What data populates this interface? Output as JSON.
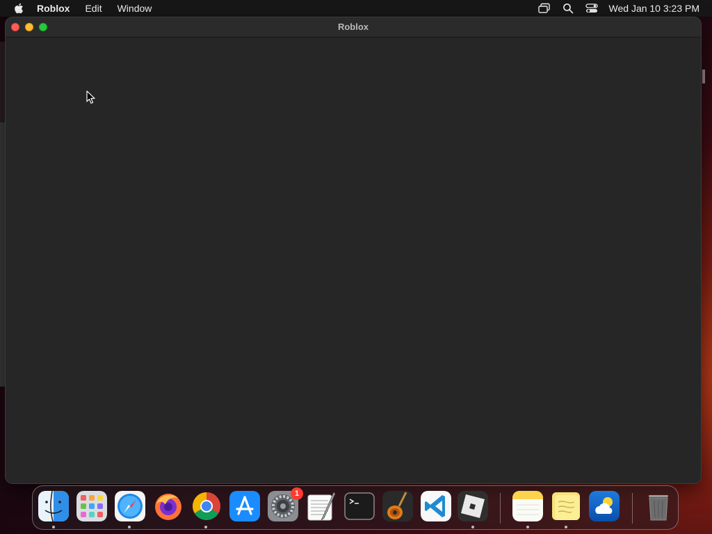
{
  "menubar": {
    "app_name": "Roblox",
    "menus": [
      "Edit",
      "Window"
    ],
    "clock": "Wed Jan 10  3:23 PM"
  },
  "window": {
    "title": "Roblox"
  },
  "dock": {
    "apps": [
      {
        "icon": "finder-icon",
        "running": true
      },
      {
        "icon": "launchpad-icon",
        "running": false
      },
      {
        "icon": "safari-icon",
        "running": true
      },
      {
        "icon": "firefox-icon",
        "running": false
      },
      {
        "icon": "chrome-icon",
        "running": true
      },
      {
        "icon": "app-store-icon",
        "running": false
      },
      {
        "icon": "system-settings-icon",
        "running": false,
        "badge": "1"
      },
      {
        "icon": "textedit-icon",
        "running": false
      },
      {
        "icon": "terminal-icon",
        "running": false
      },
      {
        "icon": "garageband-icon",
        "running": false
      },
      {
        "icon": "vscode-icon",
        "running": false
      },
      {
        "icon": "roblox-icon",
        "running": true
      },
      {
        "icon": "notes-icon",
        "running": true
      },
      {
        "icon": "stickies-icon",
        "running": true
      },
      {
        "icon": "weather-icon",
        "running": false
      },
      {
        "icon": "trash-icon",
        "running": false
      }
    ]
  },
  "colors": {
    "close": "#ff5f57",
    "minimize": "#febc2e",
    "maximize": "#28c840",
    "window_bg": "#262626",
    "menubar_bg": "#171717"
  }
}
